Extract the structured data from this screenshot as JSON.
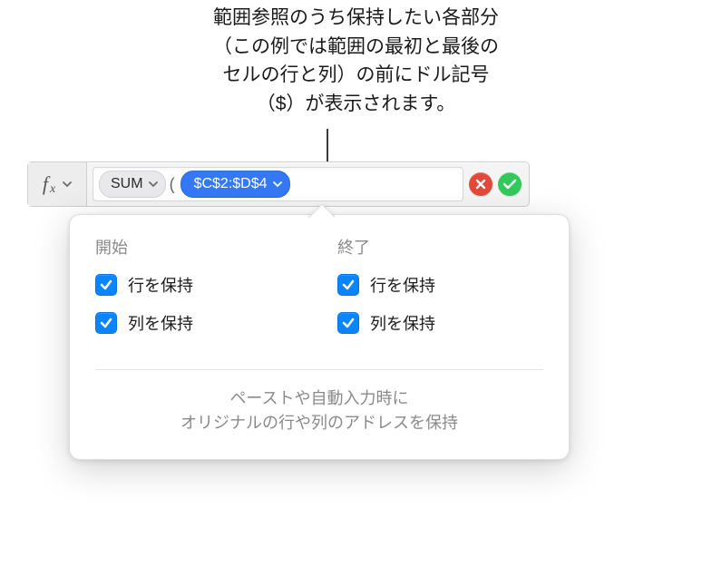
{
  "annotation": {
    "line1": "範囲参照のうち保持したい各部分",
    "line2": "（この例では範囲の最初と最後の",
    "line3": "セルの行と列）の前にドル記号",
    "line4": "（$）が表示されます。"
  },
  "formula": {
    "function_name": "SUM",
    "reference": "$C$2:$D$4",
    "open_paren": "("
  },
  "popover": {
    "start": {
      "title": "開始",
      "keep_row": "行を保持",
      "keep_col": "列を保持"
    },
    "end": {
      "title": "終了",
      "keep_row": "行を保持",
      "keep_col": "列を保持"
    },
    "footnote_line1": "ペーストや自動入力時に",
    "footnote_line2": "オリジナルの行や列のアドレスを保持"
  }
}
